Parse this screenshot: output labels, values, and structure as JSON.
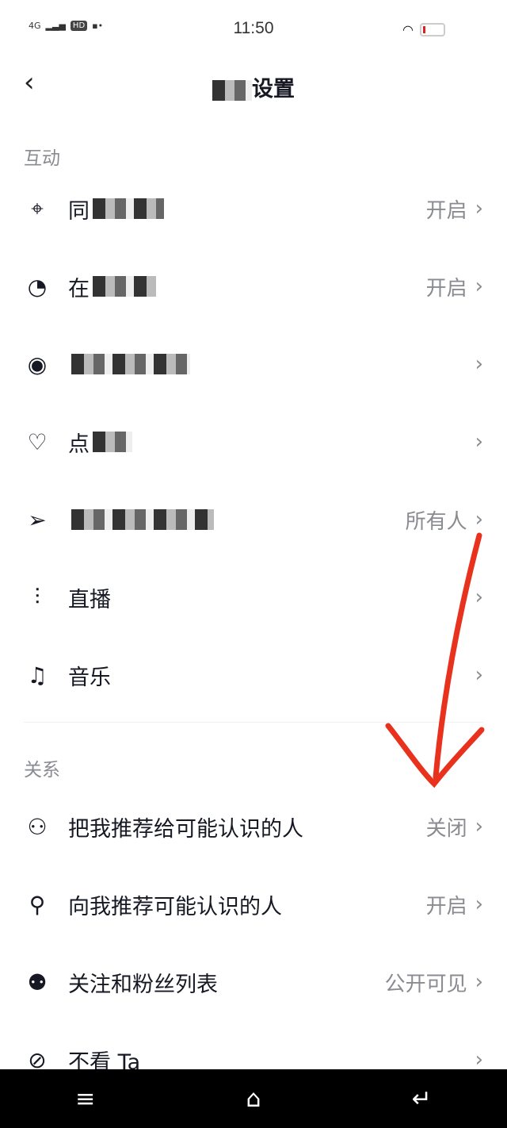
{
  "status": {
    "network": "4G",
    "hd": "HD",
    "time": "11:50"
  },
  "header": {
    "title_visible": "设置"
  },
  "sections": [
    {
      "title": "互动",
      "items": [
        {
          "icon": "location-pin-icon",
          "label": "同",
          "value": "开启"
        },
        {
          "icon": "online-status-icon",
          "label": "在",
          "value": "开启"
        },
        {
          "icon": "eye-icon",
          "label": "",
          "value": ""
        },
        {
          "icon": "heart-icon",
          "label": "点",
          "value": ""
        },
        {
          "icon": "paper-plane-icon",
          "label": "",
          "value": "所有人"
        },
        {
          "icon": "live-bars-icon",
          "label": "直播",
          "value": ""
        },
        {
          "icon": "music-note-icon",
          "label": "音乐",
          "value": ""
        }
      ]
    },
    {
      "title": "关系",
      "items": [
        {
          "icon": "share-user-icon",
          "label": "把我推荐给可能认识的人",
          "value": "关闭"
        },
        {
          "icon": "recommend-user-icon",
          "label": "向我推荐可能认识的人",
          "value": "开启"
        },
        {
          "icon": "users-icon",
          "label": "关注和粉丝列表",
          "value": "公开可见"
        },
        {
          "icon": "eye-off-icon",
          "label": "不看 Ta",
          "value": ""
        }
      ]
    }
  ],
  "annotation_color": "#e8321e"
}
